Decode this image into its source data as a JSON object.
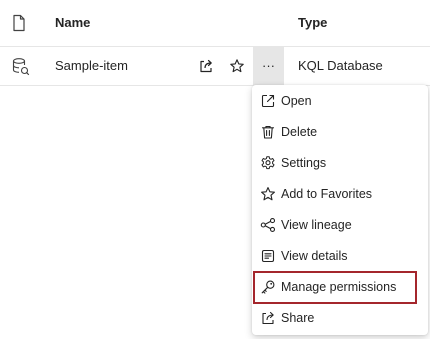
{
  "table": {
    "columns": {
      "name": "Name",
      "type": "Type"
    },
    "rows": [
      {
        "name": "Sample-item",
        "type": "KQL Database",
        "more_label": "···"
      }
    ]
  },
  "context_menu": {
    "items": [
      {
        "label": "Open",
        "icon": "open-external-icon"
      },
      {
        "label": "Delete",
        "icon": "trash-icon"
      },
      {
        "label": "Settings",
        "icon": "gear-icon"
      },
      {
        "label": "Add to Favorites",
        "icon": "star-icon"
      },
      {
        "label": "View lineage",
        "icon": "lineage-icon"
      },
      {
        "label": "View details",
        "icon": "details-icon"
      },
      {
        "label": "Manage permissions",
        "icon": "key-icon",
        "highlighted": true
      },
      {
        "label": "Share",
        "icon": "share-icon"
      }
    ]
  },
  "colors": {
    "highlight_border": "#a4262c",
    "more_button_bg": "#e6e6e6",
    "divider": "#e6e6e6"
  }
}
